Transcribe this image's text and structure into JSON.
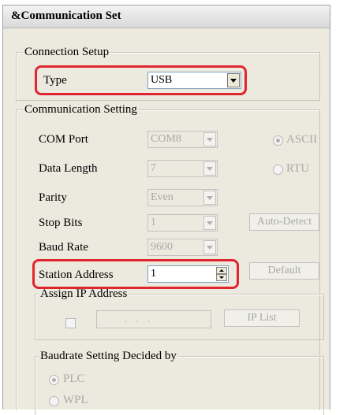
{
  "window": {
    "title": "&Communication Set"
  },
  "connection_setup": {
    "legend": "Connection Setup",
    "type_label": "Type",
    "type_value": "USB"
  },
  "communication_setting": {
    "legend": "Communication Setting",
    "com_port": {
      "label": "COM Port",
      "value": "COM8"
    },
    "data_length": {
      "label": "Data Length",
      "value": "7"
    },
    "parity": {
      "label": "Parity",
      "value": "Even"
    },
    "stop_bits": {
      "label": "Stop Bits",
      "value": "1"
    },
    "baud_rate": {
      "label": "Baud Rate",
      "value": "9600"
    },
    "station_address": {
      "label": "Station Address",
      "value": "1"
    },
    "mode_ascii": "ASCII",
    "mode_rtu": "RTU",
    "auto_detect_label": "Auto-Detect",
    "default_label": "Default",
    "selected_mode": "ASCII"
  },
  "assign_ip": {
    "legend": "Assign IP Address",
    "ip_value": ". . .",
    "ip_list_label": "IP List",
    "checked": false
  },
  "baudrate_decided": {
    "legend": "Baudrate Setting Decided by",
    "option_plc": "PLC",
    "option_wpl": "WPL",
    "selected": "PLC"
  },
  "highlight_color": "#e0262e"
}
